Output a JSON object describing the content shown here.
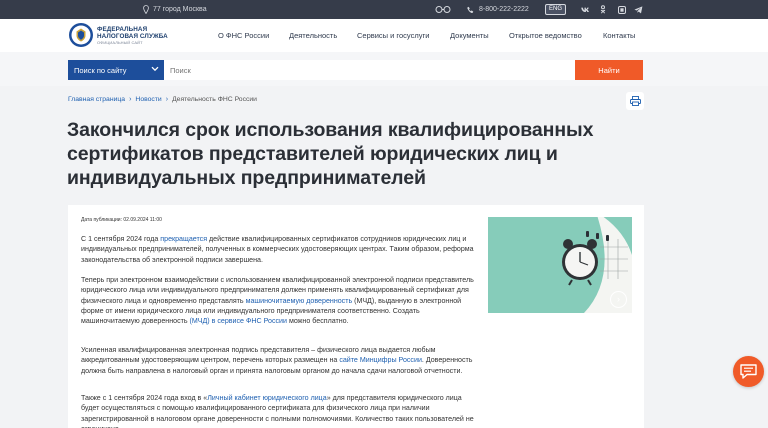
{
  "topbar": {
    "region": "77 город Москва",
    "phone": "8-800-222-2222",
    "lang": "ENG"
  },
  "header": {
    "brand_line1": "ФЕДЕРАЛЬНАЯ",
    "brand_line2": "НАЛОГОВАЯ СЛУЖБА",
    "brand_sub": "ОФИЦИАЛЬНЫЙ САЙТ",
    "nav": [
      "О ФНС России",
      "Деятельность",
      "Сервисы и госуслуги",
      "Документы",
      "Открытое ведомство",
      "Контакты"
    ]
  },
  "search": {
    "scope": "Поиск по сайту",
    "placeholder": "Поиск",
    "button": "Найти"
  },
  "breadcrumb": {
    "home": "Главная страница",
    "news": "Новости",
    "current": "Деятельность ФНС России"
  },
  "article": {
    "title": "Закончился срок использования квалифицированных сертификатов представителей юридических лиц и индивидуальных предпринимателей",
    "pubdate": "Дата публикации: 02.09.2024 11:00",
    "p1_a": "С 1 сентября 2024 года ",
    "p1_link": "прекращается",
    "p1_b": " действие квалифицированных сертификатов сотрудников юридических лиц и индивидуальных предпринимателей, полученных в коммерческих удостоверяющих центрах. Таким образом, реформа законодательства об электронной подписи завершена.",
    "p2_a": "Теперь при электронном взаимодействии с использованием квалифицированной электронной подписи представитель юридического лица или индивидуального предпринимателя должен применять квалифицированный сертификат для физического лица и одновременно представлять ",
    "p2_link1": "машиночитаемую доверенность",
    "p2_b": " (МЧД), выданную в электронной форме от имени юридического лица или индивидуального предпринимателя соответственно. Создать машиночитаемую доверенность ",
    "p2_link2": "(МЧД) в сервисе ФНС России",
    "p2_c": " можно бесплатно.",
    "p3_a": "Усиленная квалифицированная электронная подпись представителя – физического лица выдается любым аккредитованным удостоверяющим центром, перечень которых размещен на ",
    "p3_link": "сайте Минцифры России",
    "p3_b": ". Доверенность должна быть направлена в налоговый орган и принята налоговым органом до начала сдачи налоговой отчетности.",
    "p4_a": "Также с 1 сентября 2024 года вход в «",
    "p4_link": "Личный кабинет юридического лица",
    "p4_b": "» для представителя юридического лица будет осуществляться с помощью квалифицированного сертификата для физического лица при наличии зарегистрированной в налоговом органе доверенности с полными полномочиями. Количество таких пользователей не ограничено."
  },
  "colors": {
    "topbar": "#363c4a",
    "brand_blue": "#1d4e9b",
    "accent_orange": "#f05a28",
    "link": "#1d5fb0"
  }
}
